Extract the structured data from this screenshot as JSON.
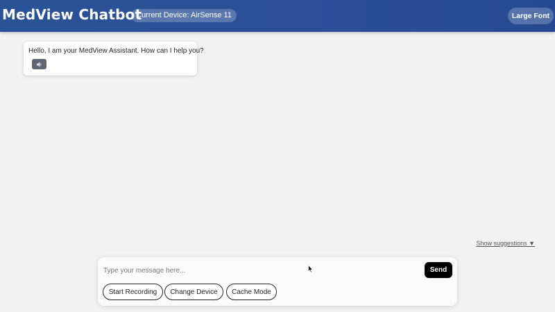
{
  "header": {
    "title": "MedView Chatbot",
    "device_label": "Current Device: AirSense 11",
    "font_button": "Large Font"
  },
  "chat": {
    "messages": [
      {
        "sender": "bot",
        "text": "Hello, I am your MedView Assistant. How can I help you?",
        "action_icon": "speaker-icon"
      }
    ]
  },
  "suggestions": {
    "toggle_label": "Show suggestions ▼"
  },
  "composer": {
    "placeholder": "Type your message here...",
    "value": "",
    "send_label": "Send",
    "actions": [
      "Start Recording",
      "Change Device",
      "Cache Mode"
    ]
  },
  "colors": {
    "header_bg": "#2a5296",
    "page_bg": "#f2f2f3",
    "send_bg": "#000000",
    "speak_button_bg": "#5e6674"
  }
}
